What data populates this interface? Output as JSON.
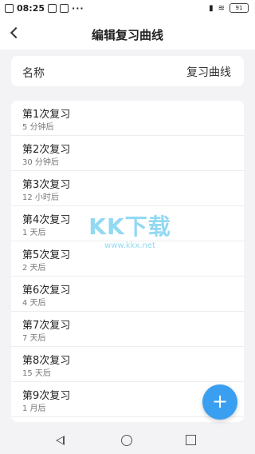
{
  "status_bar": {
    "time": "08:25",
    "dots": "···",
    "battery": "91"
  },
  "header": {
    "title": "编辑复习曲线"
  },
  "name_row": {
    "label": "名称",
    "value": "复习曲线"
  },
  "reviews": [
    {
      "title": "第1次复习",
      "interval": "5 分钟后"
    },
    {
      "title": "第2次复习",
      "interval": "30 分钟后"
    },
    {
      "title": "第3次复习",
      "interval": "12 小时后"
    },
    {
      "title": "第4次复习",
      "interval": "1 天后"
    },
    {
      "title": "第5次复习",
      "interval": "2 天后"
    },
    {
      "title": "第6次复习",
      "interval": "4 天后"
    },
    {
      "title": "第7次复习",
      "interval": "7 天后"
    },
    {
      "title": "第8次复习",
      "interval": "15 天后"
    },
    {
      "title": "第9次复习",
      "interval": "1 月后"
    }
  ],
  "watermark": {
    "logo": "KK下载",
    "url": "www.kkx.net"
  },
  "fab": {
    "label": "+",
    "color": "#3a9ff0"
  }
}
